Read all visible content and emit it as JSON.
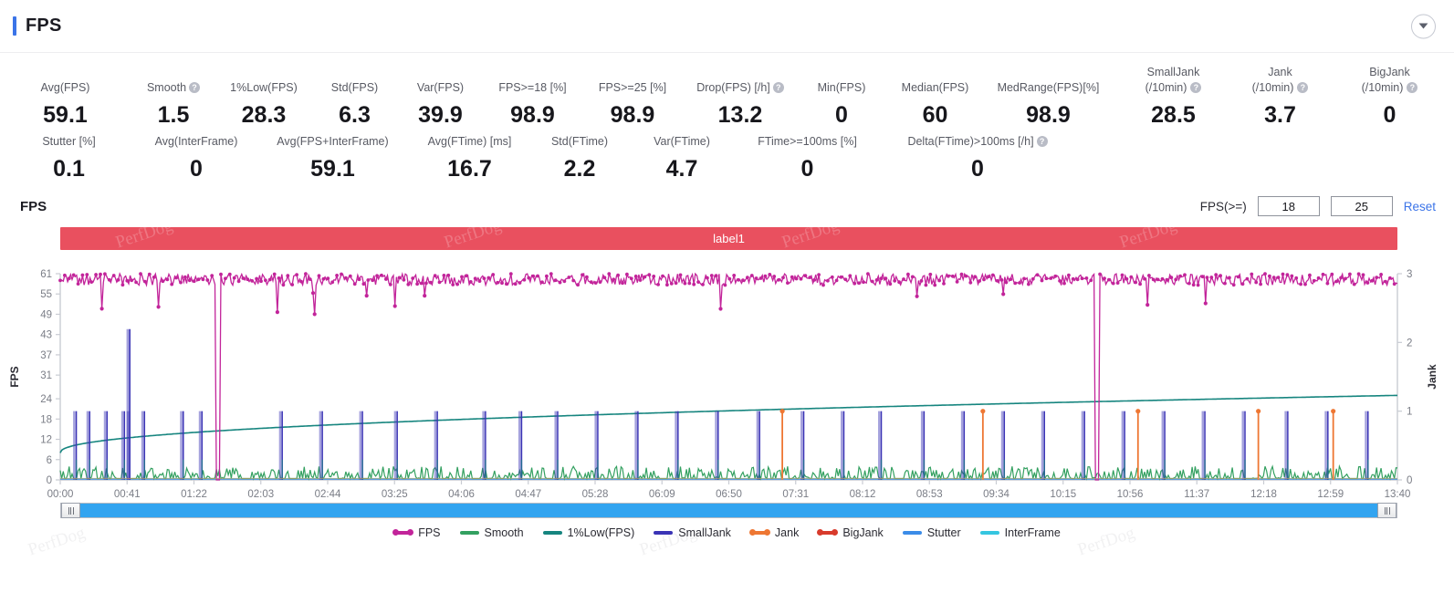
{
  "header": {
    "title": "FPS",
    "accent_color": "#3b74e8",
    "collapse_icon": "chevron-down-icon"
  },
  "stats": {
    "row1": [
      {
        "label": "Avg(FPS)",
        "value": "59.1",
        "help": false
      },
      {
        "label": "Smooth",
        "value": "1.5",
        "help": true
      },
      {
        "label": "1%Low(FPS)",
        "value": "28.3",
        "help": false
      },
      {
        "label": "Std(FPS)",
        "value": "6.3",
        "help": false
      },
      {
        "label": "Var(FPS)",
        "value": "39.9",
        "help": false
      },
      {
        "label": "FPS>=18 [%]",
        "value": "98.9",
        "help": false
      },
      {
        "label": "FPS>=25 [%]",
        "value": "98.9",
        "help": false
      },
      {
        "label": "Drop(FPS) [/h]",
        "value": "13.2",
        "help": true
      },
      {
        "label": "Min(FPS)",
        "value": "0",
        "help": false
      },
      {
        "label": "Median(FPS)",
        "value": "60",
        "help": false
      },
      {
        "label": "MedRange(FPS)[%]",
        "value": "98.9",
        "help": false
      },
      {
        "label": "SmallJank",
        "label2": "(/10min)",
        "value": "28.5",
        "help": true
      },
      {
        "label": "Jank",
        "label2": "(/10min)",
        "value": "3.7",
        "help": true
      },
      {
        "label": "BigJank",
        "label2": "(/10min)",
        "value": "0",
        "help": true
      }
    ],
    "row2": [
      {
        "label": "Stutter [%]",
        "value": "0.1",
        "help": false
      },
      {
        "label": "Avg(InterFrame)",
        "value": "0",
        "help": false
      },
      {
        "label": "Avg(FPS+InterFrame)",
        "value": "59.1",
        "help": false
      },
      {
        "label": "Avg(FTime) [ms]",
        "value": "16.7",
        "help": false
      },
      {
        "label": "Std(FTime)",
        "value": "2.2",
        "help": false
      },
      {
        "label": "Var(FTime)",
        "value": "4.7",
        "help": false
      },
      {
        "label": "FTime>=100ms [%]",
        "value": "0",
        "help": false
      },
      {
        "label": "Delta(FTime)>100ms [/h]",
        "value": "0",
        "help": true
      }
    ]
  },
  "chart_panel": {
    "title": "FPS",
    "controls": {
      "label": "FPS(>=)",
      "threshold_low": "18",
      "threshold_high": "25",
      "reset_label": "Reset"
    },
    "label_bar": {
      "text": "label1",
      "color": "#e9505f",
      "watermark": "PerfDog"
    },
    "slider": {
      "left_handle": "slider-grip",
      "right_handle": "slider-grip",
      "fill_color": "#32a4f0"
    }
  },
  "chart_data": {
    "type": "line",
    "title": "FPS",
    "xlabel": "",
    "ylabel": "FPS",
    "y2label": "Jank",
    "grid": false,
    "legend_position": "bottom",
    "x_ticks": [
      "00:00",
      "00:41",
      "01:22",
      "02:03",
      "02:44",
      "03:25",
      "04:06",
      "04:47",
      "05:28",
      "06:09",
      "06:50",
      "07:31",
      "08:12",
      "08:53",
      "09:34",
      "10:15",
      "10:56",
      "11:37",
      "12:18",
      "12:59",
      "13:40"
    ],
    "y_ticks": [
      0,
      6,
      12,
      18,
      24,
      31,
      37,
      43,
      49,
      55,
      61
    ],
    "ylim": [
      0,
      61
    ],
    "y2_ticks": [
      0,
      1,
      2,
      3
    ],
    "y2lim": [
      0,
      3
    ],
    "series": [
      {
        "name": "FPS",
        "color": "#c2249a",
        "axis": "left",
        "style": "line-markers",
        "baseline": 59.1,
        "notes": "dense oscillation 57-61 with occasional dips to 49-55 and two full drops to 0 near 01:30 and 10:40"
      },
      {
        "name": "Smooth",
        "color": "#33a060",
        "axis": "left",
        "style": "line",
        "baseline": 1.5,
        "notes": "low-amplitude noise 0-4 across full range"
      },
      {
        "name": "1%Low(FPS)",
        "color": "#16857f",
        "axis": "left",
        "style": "line",
        "notes": "monotonic rising curve from ~8 at 00:00 to ~25 at 13:40"
      },
      {
        "name": "SmallJank",
        "color": "#3a33b5",
        "axis": "right",
        "style": "impulse",
        "notes": "~28 narrow spikes to 1 Jank (22 FPS-scale), one tall spike ~44 near 00:50"
      },
      {
        "name": "Jank",
        "color": "#ee7733",
        "axis": "right",
        "style": "impulse",
        "notes": "5 spikes to 1 near 07:20, 09:25, 11:10, 12:20, 12:55"
      },
      {
        "name": "BigJank",
        "color": "#d83b2c",
        "axis": "right",
        "style": "impulse",
        "notes": "no spikes"
      },
      {
        "name": "Stutter",
        "color": "#3b8ce8",
        "axis": "left",
        "style": "line",
        "notes": "flat near 0"
      },
      {
        "name": "InterFrame",
        "color": "#35c6e0",
        "axis": "left",
        "style": "line",
        "notes": "flat near 0"
      }
    ],
    "legend": [
      {
        "label": "FPS",
        "color": "#c2249a",
        "marker": "dotted"
      },
      {
        "label": "Smooth",
        "color": "#33a060",
        "marker": "line"
      },
      {
        "label": "1%Low(FPS)",
        "color": "#16857f",
        "marker": "line"
      },
      {
        "label": "SmallJank",
        "color": "#3a33b5",
        "marker": "line"
      },
      {
        "label": "Jank",
        "color": "#ee7733",
        "marker": "dotted"
      },
      {
        "label": "BigJank",
        "color": "#d83b2c",
        "marker": "dotted"
      },
      {
        "label": "Stutter",
        "color": "#3b8ce8",
        "marker": "line"
      },
      {
        "label": "InterFrame",
        "color": "#35c6e0",
        "marker": "line"
      }
    ]
  }
}
